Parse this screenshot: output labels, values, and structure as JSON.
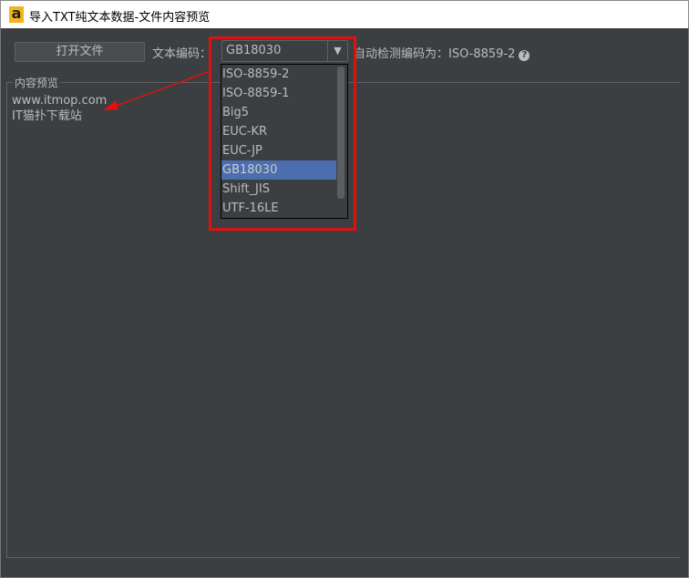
{
  "window": {
    "title": "导入TXT纯文本数据-文件内容预览",
    "logo": "a"
  },
  "toolbar": {
    "open_file": "打开文件",
    "encoding_label": "文本编码：",
    "encoding_value": "GB18030",
    "detected": "自动检测编码为：ISO-8859-2",
    "help": "?"
  },
  "dropdown": {
    "options": [
      "ISO-8859-2",
      "ISO-8859-1",
      "Big5",
      "EUC-KR",
      "EUC-JP",
      "GB18030",
      "Shift_JIS",
      "UTF-16LE"
    ],
    "selected_index": 5
  },
  "preview": {
    "title": "内容预览",
    "lines": [
      "www.itmop.com",
      "IT猫扑下载站"
    ]
  },
  "colors": {
    "annotation": "#e01010",
    "selection": "#4b6eaf"
  }
}
